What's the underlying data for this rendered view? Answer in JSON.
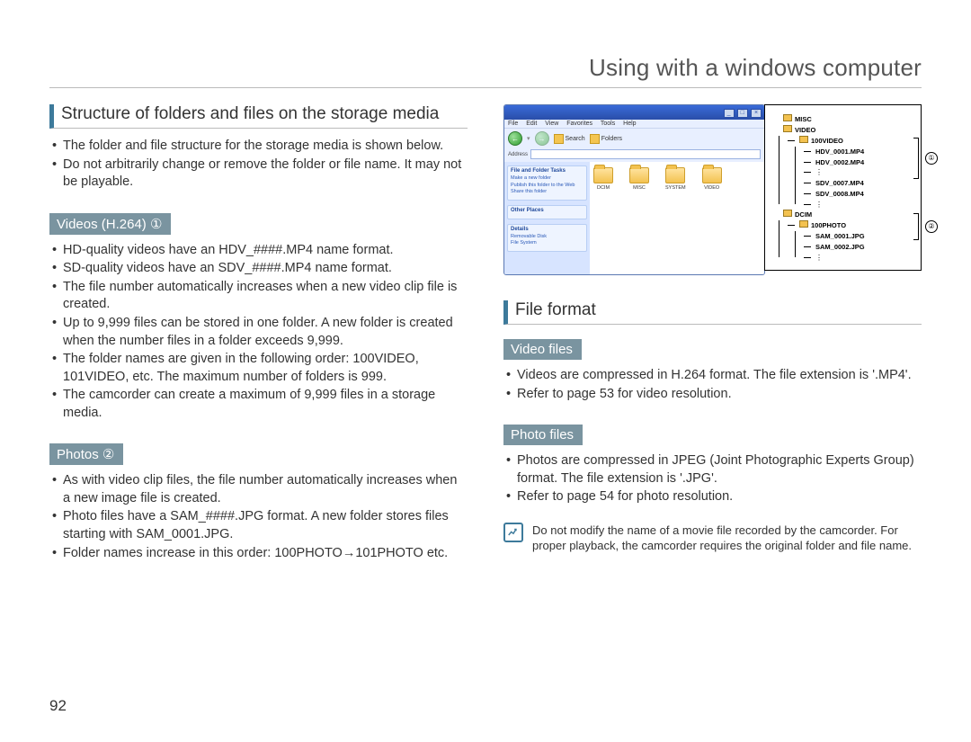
{
  "page_title": "Using with a windows computer",
  "page_number": "92",
  "left": {
    "heading1": "Structure of folders and files on the storage media",
    "list1": [
      "The folder and file structure for the storage media is shown below.",
      "Do not arbitrarily change or remove the folder or file name. It may not be playable."
    ],
    "sub1": "Videos (H.264) ①",
    "list2": [
      "HD-quality videos have an HDV_####.MP4 name format.",
      "SD-quality videos have an SDV_####.MP4 name format.",
      "The file number automatically increases when a new video clip file is created.",
      "Up to 9,999 files can be stored in one folder. A new folder is created when the number files in a folder exceeds 9,999.",
      "The folder names are given in the following order: 100VIDEO, 101VIDEO, etc. The maximum number of folders is 999.",
      "The camcorder can create a maximum of 9,999 files in a storage media."
    ],
    "sub2": "Photos ②",
    "list3": [
      "As with video clip files, the file number automatically increases when a new image file is created.",
      "Photo files have a SAM_####.JPG format. A new folder stores files starting with SAM_0001.JPG.",
      "Folder names increase in this order: 100PHOTO→101PHOTO etc."
    ]
  },
  "right": {
    "explorer": {
      "menubar": [
        "File",
        "Edit",
        "View",
        "Favorites",
        "Tools",
        "Help"
      ],
      "toolbar": {
        "back": "←",
        "search": "Search",
        "folders": "Folders"
      },
      "task_groups": [
        {
          "title": "File and Folder Tasks",
          "items": [
            "Make a new folder",
            "Publish this folder to the Web",
            "Share this folder"
          ]
        },
        {
          "title": "Other Places",
          "items": []
        },
        {
          "title": "Details",
          "items": [
            "Removable Disk",
            "File System"
          ]
        }
      ],
      "folders": [
        "DCIM",
        "MISC",
        "SYSTEM",
        "VIDEO"
      ]
    },
    "tree": {
      "misc": "MISC",
      "video": "VIDEO",
      "video_sub": "100VIDEO",
      "video_files": [
        "HDV_0001.MP4",
        "HDV_0002.MP4",
        "SDV_0007.MP4",
        "SDV_0008.MP4"
      ],
      "dcim": "DCIM",
      "dcim_sub": "100PHOTO",
      "dcim_files": [
        "SAM_0001.JPG",
        "SAM_0002.JPG"
      ],
      "mark1": "①",
      "mark2": "②"
    },
    "heading2": "File format",
    "sub3": "Video files",
    "list4": [
      "Videos are compressed in H.264 format. The file extension is '.MP4'.",
      "Refer to page 53 for video resolution."
    ],
    "sub4": "Photo files",
    "list5": [
      "Photos are compressed in JPEG (Joint Photographic Experts Group) format. The file extension is '.JPG'.",
      "Refer to page 54 for photo resolution."
    ],
    "note": "Do not modify the name of a movie file recorded by the camcorder. For proper playback, the camcorder requires the original folder and file name."
  }
}
